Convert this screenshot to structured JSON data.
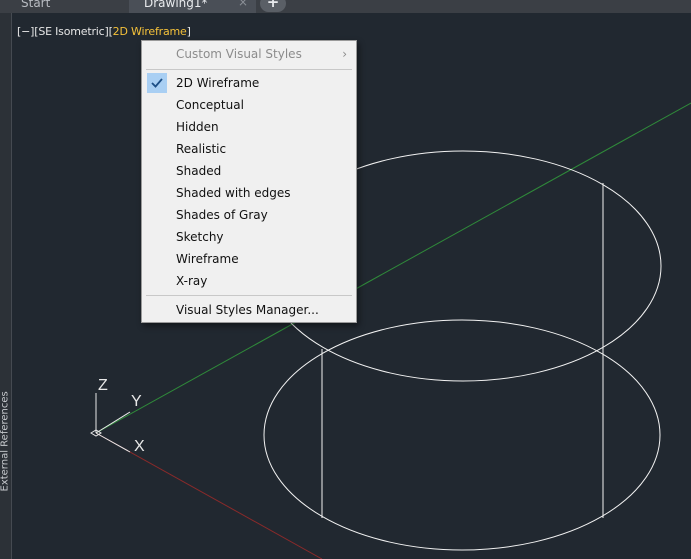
{
  "tabs": [
    {
      "label": "Start"
    },
    {
      "label": "Drawing1*"
    }
  ],
  "new_tab_icon": "+",
  "close_icon": "×",
  "side_panel": {
    "label": "External References"
  },
  "viewport": {
    "controls_bracket_open": "[",
    "controls_minus": "−",
    "view_label": "SE Isometric",
    "style_label": "2D Wireframe",
    "bracket_close": "]"
  },
  "ucs": {
    "x": "X",
    "y": "Y",
    "z": "Z"
  },
  "menu": {
    "custom_styles": {
      "label": "Custom Visual Styles",
      "arrow": "›"
    },
    "items": [
      {
        "label": "2D Wireframe",
        "checked": true
      },
      {
        "label": "Conceptual"
      },
      {
        "label": "Hidden"
      },
      {
        "label": "Realistic"
      },
      {
        "label": "Shaded"
      },
      {
        "label": "Shaded with edges"
      },
      {
        "label": "Shades of Gray"
      },
      {
        "label": "Sketchy"
      },
      {
        "label": "Wireframe"
      },
      {
        "label": "X-ray"
      }
    ],
    "manager": {
      "label": "Visual Styles Manager..."
    }
  },
  "colors": {
    "canvas": "#212830",
    "accent_yellow": "#f4c13a",
    "axis_green": "#2f8a3a",
    "axis_red": "#8a2a2a",
    "menu_highlight": "#a9cff3"
  }
}
